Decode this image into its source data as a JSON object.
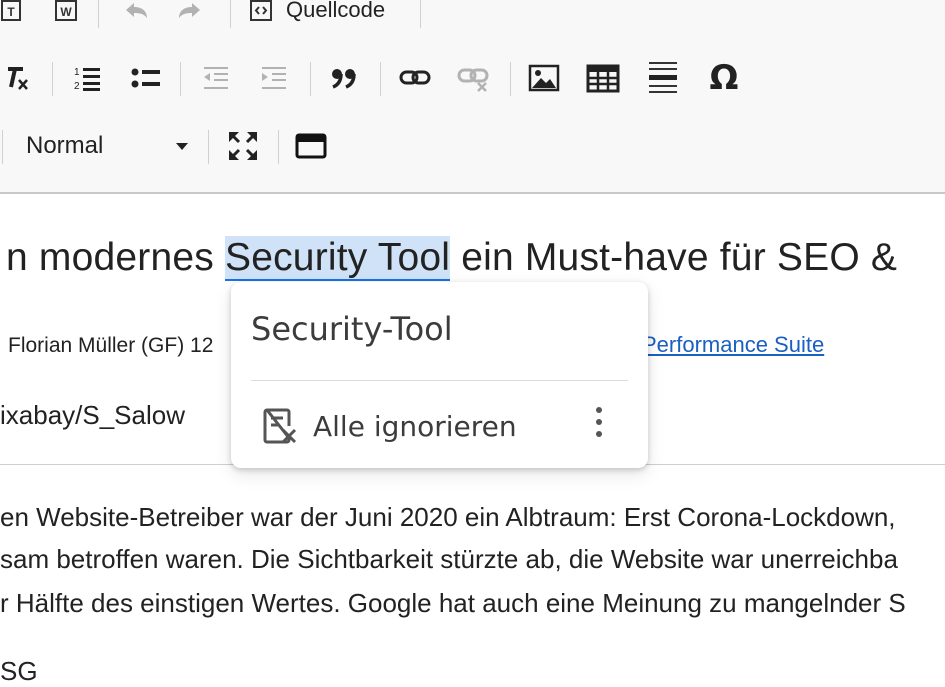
{
  "toolbar": {
    "source_label": "Quellcode",
    "format_value": "Normal"
  },
  "content": {
    "heading_before": "n modernes ",
    "heading_selected": "Security Tool",
    "heading_after": " ein Must-have für SEO &",
    "byline": "Florian Müller (GF) 12",
    "link": "Performance Suite",
    "image_credit": "ixabay/S_Salow",
    "paragraph_lines": [
      "en Website-Betreiber war der Juni 2020 ein Albtraum: Erst Corona-Lockdown,",
      "sam betroffen waren. Die Sichtbarkeit stürzte ab, die Website war unerreichba",
      "r Hälfte des einstigen Wertes. Google hat auch eine Meinung zu mangelnder S",
      "SG"
    ]
  },
  "spellcheck_popup": {
    "suggestion": "Security-Tool",
    "ignore_all": "Alle ignorieren"
  },
  "colors": {
    "selection_highlight": "#cfe2f7",
    "link": "#1a5fc2",
    "toolbar_bg": "#f8f8f8"
  },
  "icons": [
    "paste-text-icon",
    "paste-word-icon",
    "undo-icon",
    "redo-icon",
    "source-icon",
    "remove-format-icon",
    "numbered-list-icon",
    "bulleted-list-icon",
    "outdent-icon",
    "indent-icon",
    "blockquote-icon",
    "link-icon",
    "unlink-icon",
    "image-icon",
    "table-icon",
    "horizontal-line-icon",
    "special-char-icon",
    "maximize-icon",
    "show-blocks-icon",
    "ignore-icon",
    "more-icon"
  ]
}
